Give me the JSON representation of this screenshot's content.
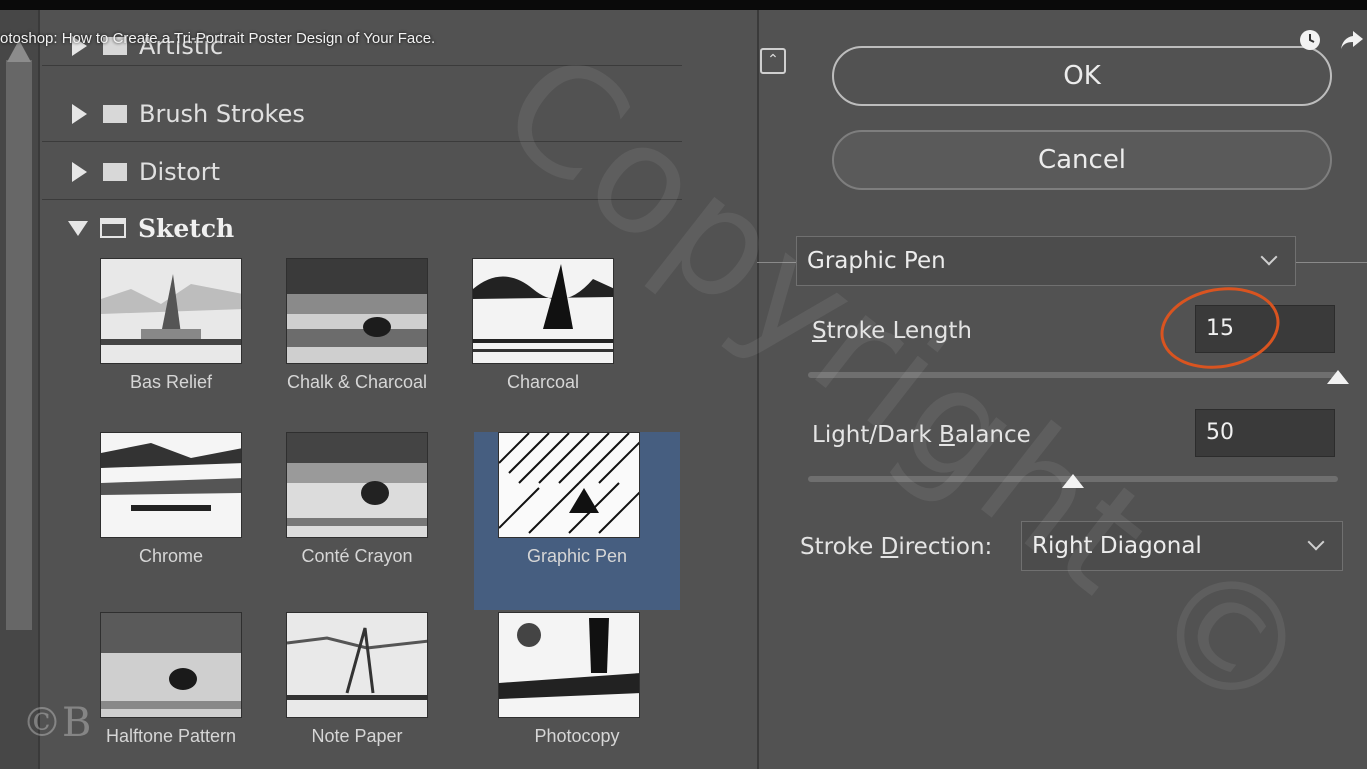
{
  "video": {
    "title": "otoshop: How to Create a Tri-Portrait Poster Design of Your Face."
  },
  "gallery": {
    "categories": [
      {
        "label": "Artistic"
      },
      {
        "label": "Brush Strokes"
      },
      {
        "label": "Distort"
      },
      {
        "label": "Sketch"
      }
    ],
    "filters": [
      {
        "label": "Bas Relief"
      },
      {
        "label": "Chalk & Charcoal"
      },
      {
        "label": "Charcoal"
      },
      {
        "label": "Chrome"
      },
      {
        "label": "Conté Crayon"
      },
      {
        "label": "Graphic Pen"
      },
      {
        "label": "Halftone Pattern"
      },
      {
        "label": "Note Paper"
      },
      {
        "label": "Photocopy"
      }
    ],
    "selected_filter": "Graphic Pen"
  },
  "panel": {
    "ok_label": "OK",
    "cancel_label": "Cancel",
    "filter_select": "Graphic Pen",
    "stroke_length": {
      "label_u": "S",
      "label_rest": "troke Length",
      "value": "15",
      "level": 1.0
    },
    "balance": {
      "label_pre": "Light/Dark ",
      "label_u": "B",
      "label_rest": "alance",
      "value": "50",
      "level": 0.5
    },
    "direction": {
      "label_pre": "Stroke ",
      "label_u": "D",
      "label_rest": "irection:",
      "value": "Right Diagonal"
    }
  },
  "colors": {
    "selection": "#465e80",
    "annotation": "#d95420",
    "background": "#525252"
  },
  "icons": [
    "clock-icon",
    "share-icon",
    "collapse-icon",
    "folder-icon",
    "triangle-icon",
    "chevron-down-icon"
  ]
}
